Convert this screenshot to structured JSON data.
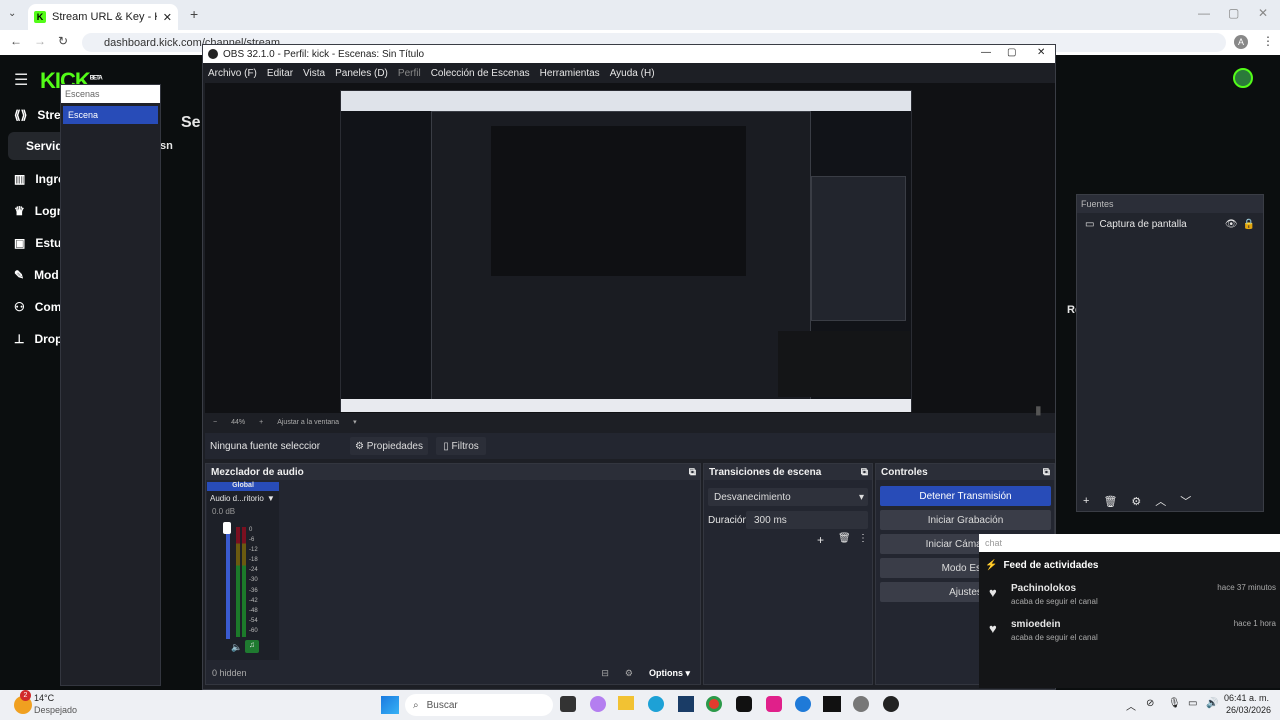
{
  "browser": {
    "tab_title": "Stream URL & Key - Kick Dashb",
    "url": "dashboard.kick.com/channel/stream",
    "profile": "A"
  },
  "kick": {
    "logo": "KICK",
    "logo_beta": "BETA",
    "heading_partial": "Se",
    "nav": [
      "Strea",
      "Servid",
      "Ingre",
      "Logr",
      "Estu",
      "Mod",
      "Com",
      "Drop"
    ],
    "partial_sn": "sn",
    "partial_re": "Re"
  },
  "obs": {
    "title": "OBS 32.1.0 - Perfil: kick - Escenas: Sin Título",
    "menu": [
      "Archivo (F)",
      "Editar",
      "Vista",
      "Paneles (D)",
      "Perfil",
      "Colección de Escenas",
      "Herramientas",
      "Ayuda (H)"
    ],
    "zoom": {
      "minus": "−",
      "value": "44%",
      "plus": "+",
      "fit": "Ajustar a la ventana"
    },
    "context": {
      "no_source": "Ninguna fuente seleccionac",
      "properties": "Propiedades",
      "filters": "Filtros"
    },
    "scenes": {
      "title": "Escenas",
      "items": [
        "Escena"
      ]
    },
    "sources": {
      "title": "Fuentes",
      "items": [
        "Captura de pantalla"
      ]
    },
    "mixer": {
      "title": "Mezclador de audio",
      "global": "Global",
      "device": "Audio d...ritorio",
      "db": "0.0 dB",
      "scale": [
        "0",
        "-6",
        "-12",
        "-18",
        "-24",
        "-30",
        "-36",
        "-42",
        "-48",
        "-54",
        "-60"
      ],
      "hidden": "0 hidden",
      "options": "Options"
    },
    "transitions": {
      "title": "Transiciones de escena",
      "selected": "Desvanecimiento",
      "duration_label": "Duración",
      "duration_value": "300 ms"
    },
    "controls": {
      "title": "Controles",
      "buttons": [
        "Detener Transmisión",
        "Iniciar Grabación",
        "Iniciar Cámara Vir",
        "Modo Estu",
        "Ajustes"
      ]
    }
  },
  "chat": {
    "search": "chat",
    "feed_title": "Feed de actividades",
    "items": [
      {
        "user": "Pachinolokos",
        "sub": "acaba de seguir el canal",
        "time": "hace 37 minutos"
      },
      {
        "user": "smioedein",
        "sub": "acaba de seguir el canal",
        "time": "hace 1 hora"
      }
    ]
  },
  "taskbar": {
    "weather_temp": "14°C",
    "weather_desc": "Despejado",
    "badge": "2",
    "search": "Buscar",
    "time": "06:41 a. m.",
    "date": "26/03/2026"
  },
  "colors": {
    "kick_green": "#53fc18",
    "obs_accent": "#284cb8"
  }
}
